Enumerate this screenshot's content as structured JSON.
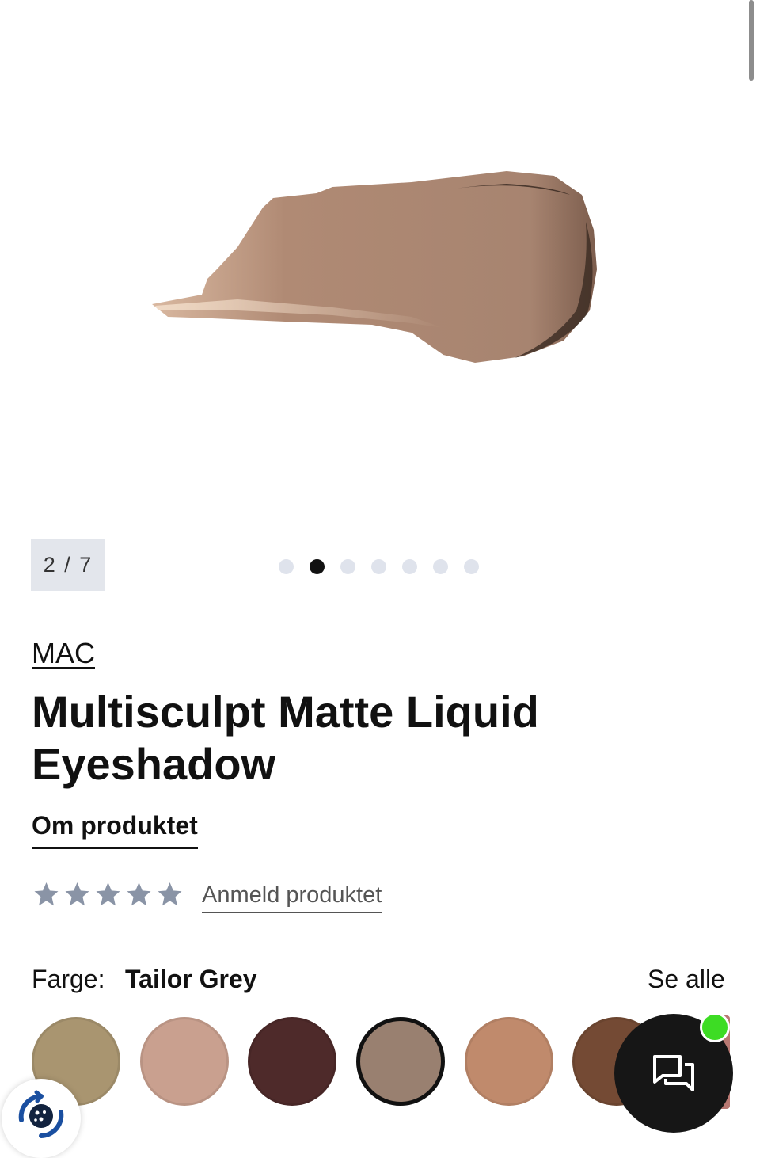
{
  "gallery": {
    "counter": "2 / 7",
    "total_slides": 7,
    "active_slide": 2,
    "image_alt": "eyeshadow-swatch-smear"
  },
  "product": {
    "brand": "MAC",
    "title": "Multisculpt Matte Liquid Eyeshadow",
    "about_tab": "Om produktet",
    "rating_stars": 5,
    "rating_value": 0,
    "review_link": "Anmeld produktet"
  },
  "color_picker": {
    "label": "Farge:",
    "selected_name": "Tailor Grey",
    "see_all": "Se alle",
    "swatches": [
      "#a99570",
      "#c9a08f",
      "#4e2a2a",
      "#998070",
      "#c08a6c",
      "#744a34",
      "#b87872"
    ],
    "selected_index": 3
  },
  "widgets": {
    "chat_icon": "chat-bubbles-icon",
    "chat_badge_color": "#3ddc24",
    "cookie_icon": "cookie-settings-icon"
  }
}
